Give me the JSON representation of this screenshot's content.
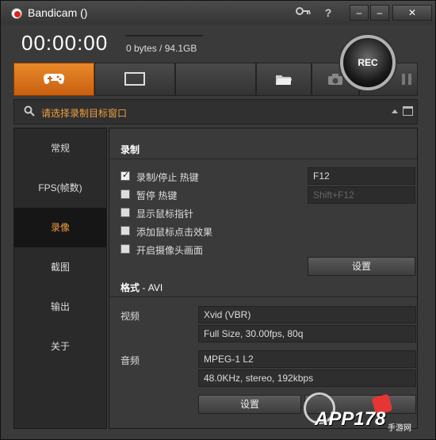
{
  "app": {
    "title": "Bandicam ()"
  },
  "titlebar": {
    "help_glyph": "?",
    "min1_glyph": "–",
    "min2_glyph": "–",
    "close_glyph": "✕"
  },
  "status": {
    "timer": "00:00:00",
    "size": "0 bytes / 94.1GB"
  },
  "record_button": {
    "label": "REC"
  },
  "search": {
    "label": "请选择录制目标窗口"
  },
  "sidebar": {
    "items": [
      "常规",
      "FPS(帧数)",
      "录像",
      "截图",
      "输出",
      "关于"
    ],
    "active_index": 2
  },
  "record_section": {
    "title": "录制",
    "options": [
      {
        "label": "录制/停止 热键",
        "checked": true
      },
      {
        "label": "暂停 热键",
        "checked": false
      },
      {
        "label": "显示鼠标指针",
        "checked": false
      },
      {
        "label": "添加鼠标点击效果",
        "checked": false
      },
      {
        "label": "开启摄像头画面",
        "checked": false
      }
    ],
    "hotkeys": [
      "F12",
      "Shift+F12"
    ],
    "settings_label": "设置"
  },
  "format_section": {
    "title": "格式",
    "format_value": "AVI",
    "video_label": "视频",
    "video_codec": "Xvid (VBR)",
    "video_detail": "Full Size, 30.00fps, 80q",
    "audio_label": "音频",
    "audio_codec": "MPEG-1 L2",
    "audio_detail": "48.0KHz, stereo, 192kbps",
    "settings_label": "设置"
  },
  "watermark": {
    "text": "APP178",
    "sub": "手游网"
  },
  "colors": {
    "accent": "#e88a2a",
    "active_text": "#f0a040",
    "background": "#3a3a3a"
  }
}
